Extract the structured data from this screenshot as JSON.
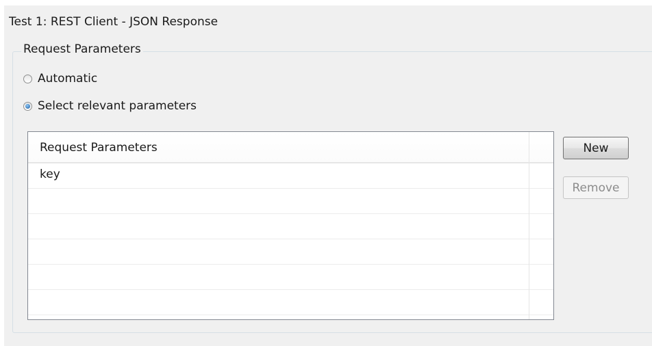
{
  "header": {
    "title": "Test 1: REST Client - JSON Response"
  },
  "request_parameters": {
    "group_label": "Request Parameters",
    "options": [
      {
        "label": "Automatic",
        "selected": false
      },
      {
        "label": "Select relevant parameters",
        "selected": true
      }
    ],
    "table": {
      "column_header": "Request Parameters",
      "rows": [
        "key",
        "",
        "",
        "",
        "",
        ""
      ]
    },
    "buttons": {
      "new_label": "New",
      "remove_label": "Remove",
      "remove_enabled": false
    }
  }
}
